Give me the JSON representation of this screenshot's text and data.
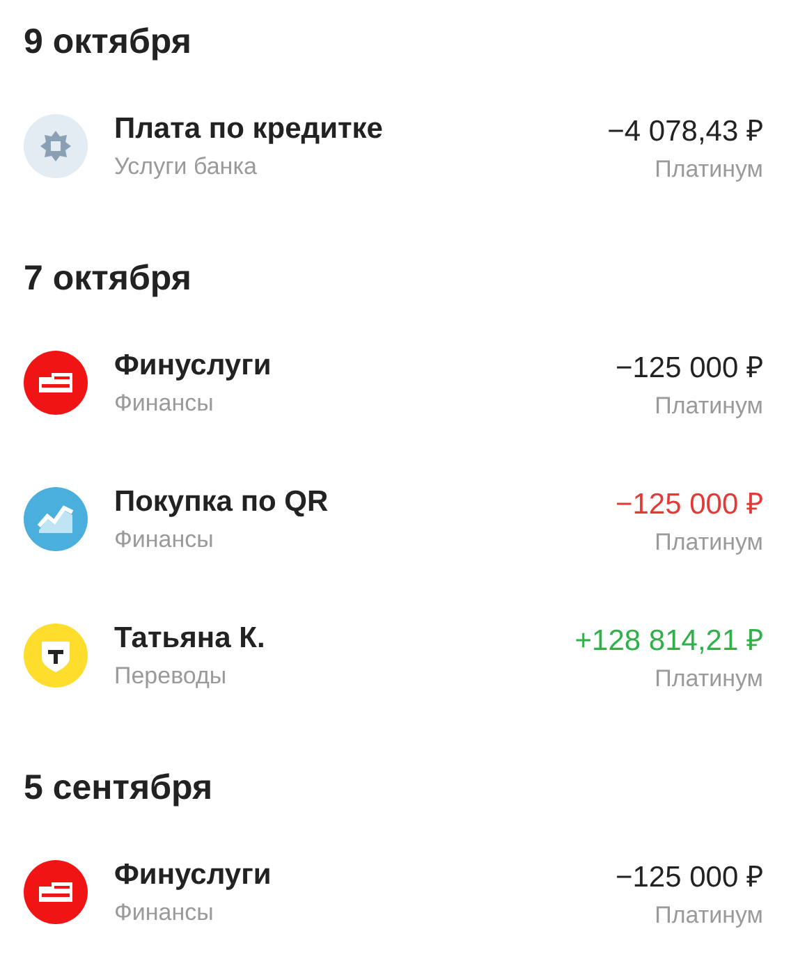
{
  "sections": [
    {
      "date": "9 октября",
      "operations": [
        {
          "kind": "bank",
          "title": "Плата по кредитке",
          "category": "Услуги банка",
          "amount": "−4 078,43 ₽",
          "color": "#222222",
          "card": "Платинум"
        }
      ]
    },
    {
      "date": "7 октября",
      "operations": [
        {
          "kind": "finservice",
          "title": "Финуслуги",
          "category": "Финансы",
          "amount": "−125 000 ₽",
          "color": "#222222",
          "card": "Платинум"
        },
        {
          "kind": "qr",
          "title": "Покупка по QR",
          "category": "Финансы",
          "amount": "−125 000 ₽",
          "color": "#e53935",
          "card": "Платинум"
        },
        {
          "kind": "transfer",
          "title": "Татьяна К.",
          "category": "Переводы",
          "amount": "+128 814,21 ₽",
          "color": "#2fb14a",
          "card": "Платинум"
        }
      ]
    },
    {
      "date": "5 сентября",
      "operations": [
        {
          "kind": "finservice",
          "title": "Финуслуги",
          "category": "Финансы",
          "amount": "−125 000 ₽",
          "color": "#222222",
          "card": "Платинум"
        }
      ]
    }
  ]
}
